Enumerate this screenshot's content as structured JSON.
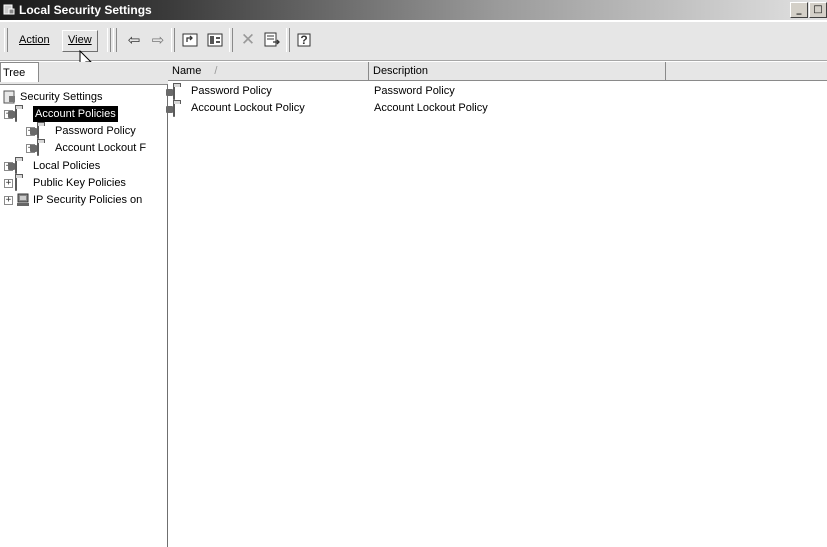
{
  "window": {
    "title": "Local Security Settings",
    "buttons": {
      "minimize": "_",
      "maximize": "□"
    }
  },
  "toolbar": {
    "action_label": "Action",
    "view_label": "View",
    "back_glyph": "⇦",
    "forward_glyph": "⇨",
    "delete_glyph": "✕",
    "help_glyph": "?"
  },
  "tree": {
    "tab_label": "Tree",
    "root": "Security Settings",
    "items": [
      {
        "label": "Account Policies",
        "expander": "−",
        "selected": true
      },
      {
        "label": "Password Policy",
        "expander": "+"
      },
      {
        "label": "Account Lockout F",
        "expander": "+"
      },
      {
        "label": "Local Policies",
        "expander": "+"
      },
      {
        "label": "Public Key Policies",
        "expander": "+"
      },
      {
        "label": "IP Security Policies on",
        "expander": "+"
      }
    ]
  },
  "list": {
    "columns": [
      "Name",
      "Description"
    ],
    "sort_indicator": "/",
    "rows": [
      {
        "name": "Password Policy",
        "description": "Password Policy"
      },
      {
        "name": "Account Lockout Policy",
        "description": "Account Lockout Policy"
      }
    ]
  },
  "colors": {
    "selection_bg": "#000000",
    "toolbar_bg": "#e6e6e6",
    "title_bar_start": "#1a1a1a"
  }
}
